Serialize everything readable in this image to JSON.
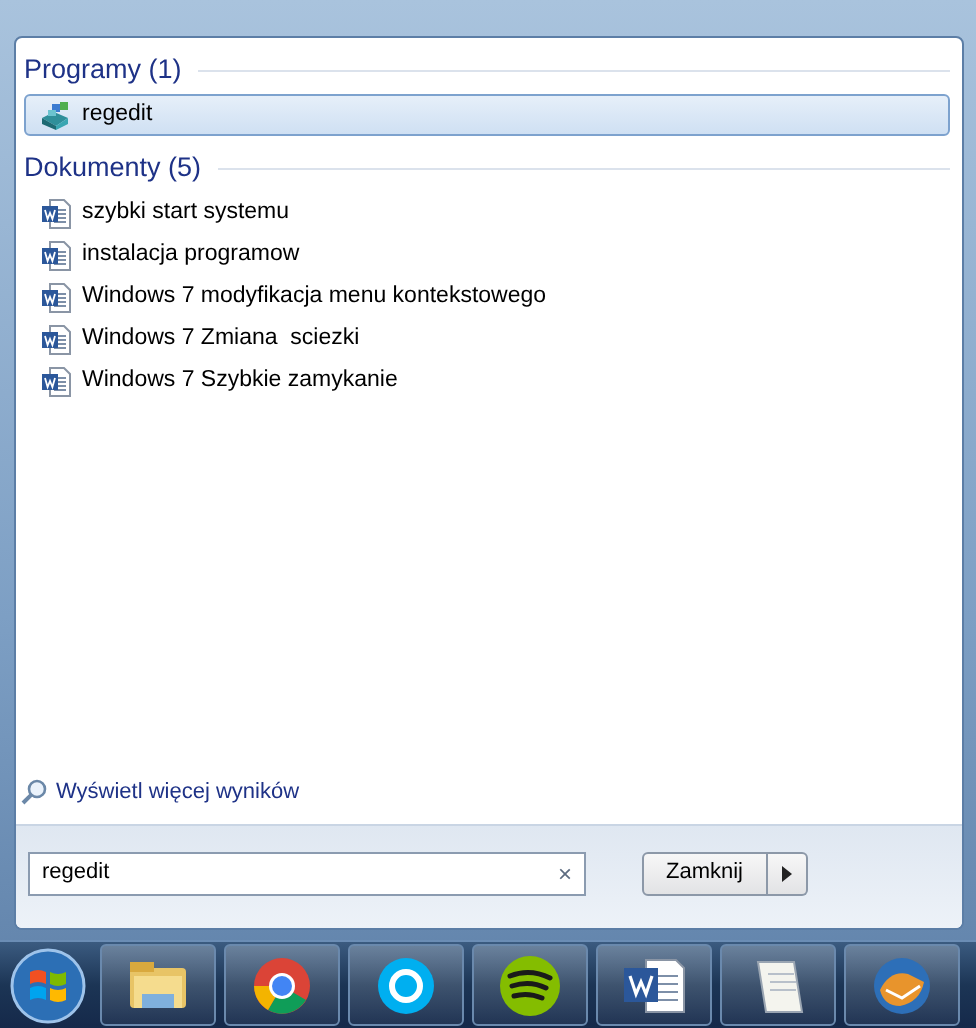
{
  "groups": [
    {
      "title": "Programy (1)",
      "items": [
        {
          "label": "regedit",
          "kind": "program",
          "selected": true
        }
      ]
    },
    {
      "title": "Dokumenty (5)",
      "items": [
        {
          "label": "szybki start systemu",
          "kind": "document",
          "selected": false
        },
        {
          "label": "instalacja programow",
          "kind": "document",
          "selected": false
        },
        {
          "label": "Windows 7 modyfikacja menu kontekstowego",
          "kind": "document",
          "selected": false
        },
        {
          "label": "Windows 7 Zmiana  sciezki",
          "kind": "document",
          "selected": false
        },
        {
          "label": "Windows 7 Szybkie zamykanie",
          "kind": "document",
          "selected": false
        }
      ]
    }
  ],
  "more_results": "Wyświetl więcej wyników",
  "search": {
    "value": "regedit",
    "clear": "×"
  },
  "shutdown_button": "Zamknij",
  "taskbar": [
    {
      "kind": "folder"
    },
    {
      "kind": "browser"
    },
    {
      "kind": "chat"
    },
    {
      "kind": "music"
    },
    {
      "kind": "word"
    },
    {
      "kind": "notepad"
    },
    {
      "kind": "mail"
    }
  ]
}
